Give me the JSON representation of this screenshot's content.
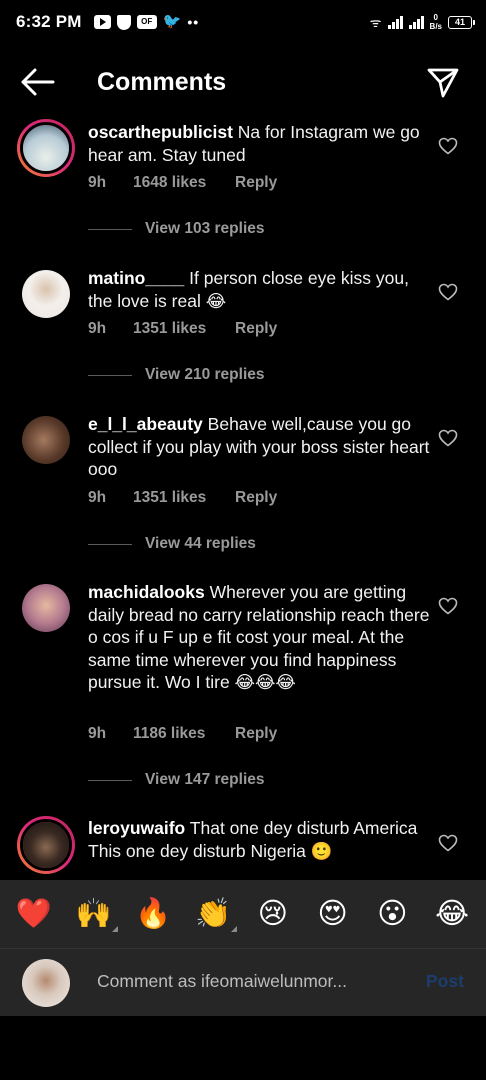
{
  "status": {
    "time": "6:32 PM",
    "netspeed_value": "0",
    "netspeed_unit": "B/s",
    "battery": "41",
    "nfc_label": "OF"
  },
  "header": {
    "title": "Comments",
    "back_icon": "arrow-left-icon",
    "share_icon": "paper-plane-icon"
  },
  "comments": [
    {
      "username": "oscarthepublicist",
      "text": "Na for Instagram we go hear am. Stay tuned",
      "time": "9h",
      "likes": "1648 likes",
      "reply": "Reply",
      "view_replies": "View 103 replies",
      "has_story": true,
      "avatar_color": "#bfd4e0"
    },
    {
      "username": "matino____",
      "text": "If person close eye kiss you, the love is real 😂",
      "time": "9h",
      "likes": "1351 likes",
      "reply": "Reply",
      "view_replies": "View 210 replies",
      "has_story": false,
      "avatar_color": "#e8e3de"
    },
    {
      "username": "e_l_l_abeauty",
      "text": "Behave well,cause you go collect if you play with your boss sister heart ooo",
      "time": "9h",
      "likes": "1351 likes",
      "reply": "Reply",
      "view_replies": "View 44 replies",
      "has_story": false,
      "avatar_color": "#6b4a3a"
    },
    {
      "username": "machidalooks",
      "text": "Wherever you are getting daily bread no carry relationship reach there o cos if u F up e fit cost your meal. At the same time wherever you find happiness pursue it. Wo I tire 😂😂😂",
      "time": "9h",
      "likes": "1186 likes",
      "reply": "Reply",
      "view_replies": "View 147 replies",
      "has_story": false,
      "avatar_color": "#c9a6b7"
    },
    {
      "username": "leroyuwaifo",
      "text": "That one dey disturb America\nThis one dey disturb Nigeria 🙂",
      "time": "",
      "likes": "",
      "reply": "",
      "view_replies": "",
      "has_story": true,
      "avatar_color": "#3a2a22"
    }
  ],
  "emoji_bar": [
    "❤️",
    "🙌",
    "🔥",
    "👏",
    "😢",
    "😍",
    "😮",
    "😂"
  ],
  "composer": {
    "placeholder": "Comment as ifeomaiwelunmor...",
    "post_label": "Post"
  },
  "colors": {
    "background": "#000000",
    "bar": "#262626",
    "muted_text": "#9a9a9a",
    "post_disabled": "#1c3d6e",
    "story_ring_start": "#f58529",
    "story_ring_end": "#dd2a7b"
  }
}
